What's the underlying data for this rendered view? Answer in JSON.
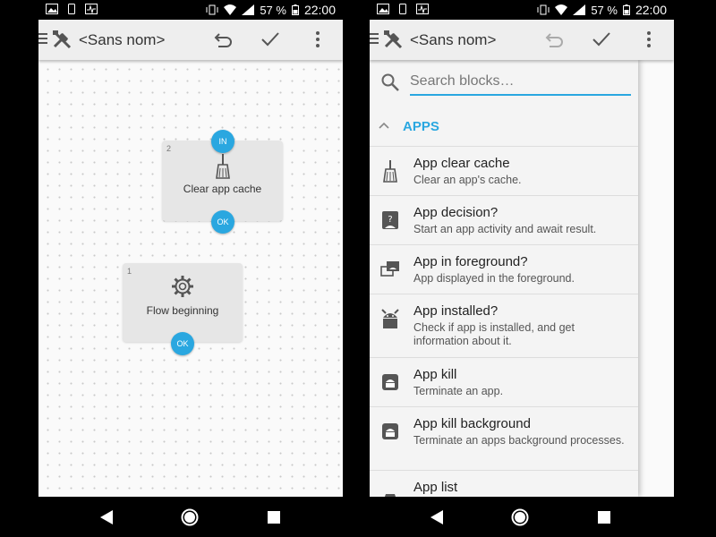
{
  "status_bar": {
    "battery_percent": "57 %",
    "time": "22:00"
  },
  "left_screen": {
    "title": "<Sans nom>",
    "blocks": [
      {
        "number": "2",
        "label": "Clear app cache",
        "in_port": "IN",
        "out_port": "OK",
        "icon": "broom-icon"
      },
      {
        "number": "1",
        "label": "Flow beginning",
        "out_port": "OK",
        "icon": "gear-icon"
      }
    ]
  },
  "right_screen": {
    "title": "<Sans nom>",
    "search": {
      "placeholder": "Search blocks…",
      "value": ""
    },
    "category": {
      "label": "APPS",
      "expanded": true
    },
    "items": [
      {
        "title": "App clear cache",
        "description": "Clear an app's cache.",
        "icon": "broom-icon"
      },
      {
        "title": "App decision?",
        "description": "Start an app activity and await result.",
        "icon": "android-question-icon"
      },
      {
        "title": "App in foreground?",
        "description": "App displayed in the foreground.",
        "icon": "window-stack-icon"
      },
      {
        "title": "App installed?",
        "description": "Check if app is installed, and get information about it.",
        "icon": "android-head-icon"
      },
      {
        "title": "App kill",
        "description": "Terminate an app.",
        "icon": "android-kill-icon"
      },
      {
        "title": "App kill background",
        "description": "Terminate an apps background processes.",
        "icon": "android-kill-icon"
      },
      {
        "title": "App list",
        "description": "",
        "icon": "app-list-icon"
      }
    ]
  },
  "colors": {
    "accent": "#2aa7e0",
    "app_bar": "#eeeeee",
    "canvas": "#fafafa",
    "block": "#e6e6e6"
  }
}
